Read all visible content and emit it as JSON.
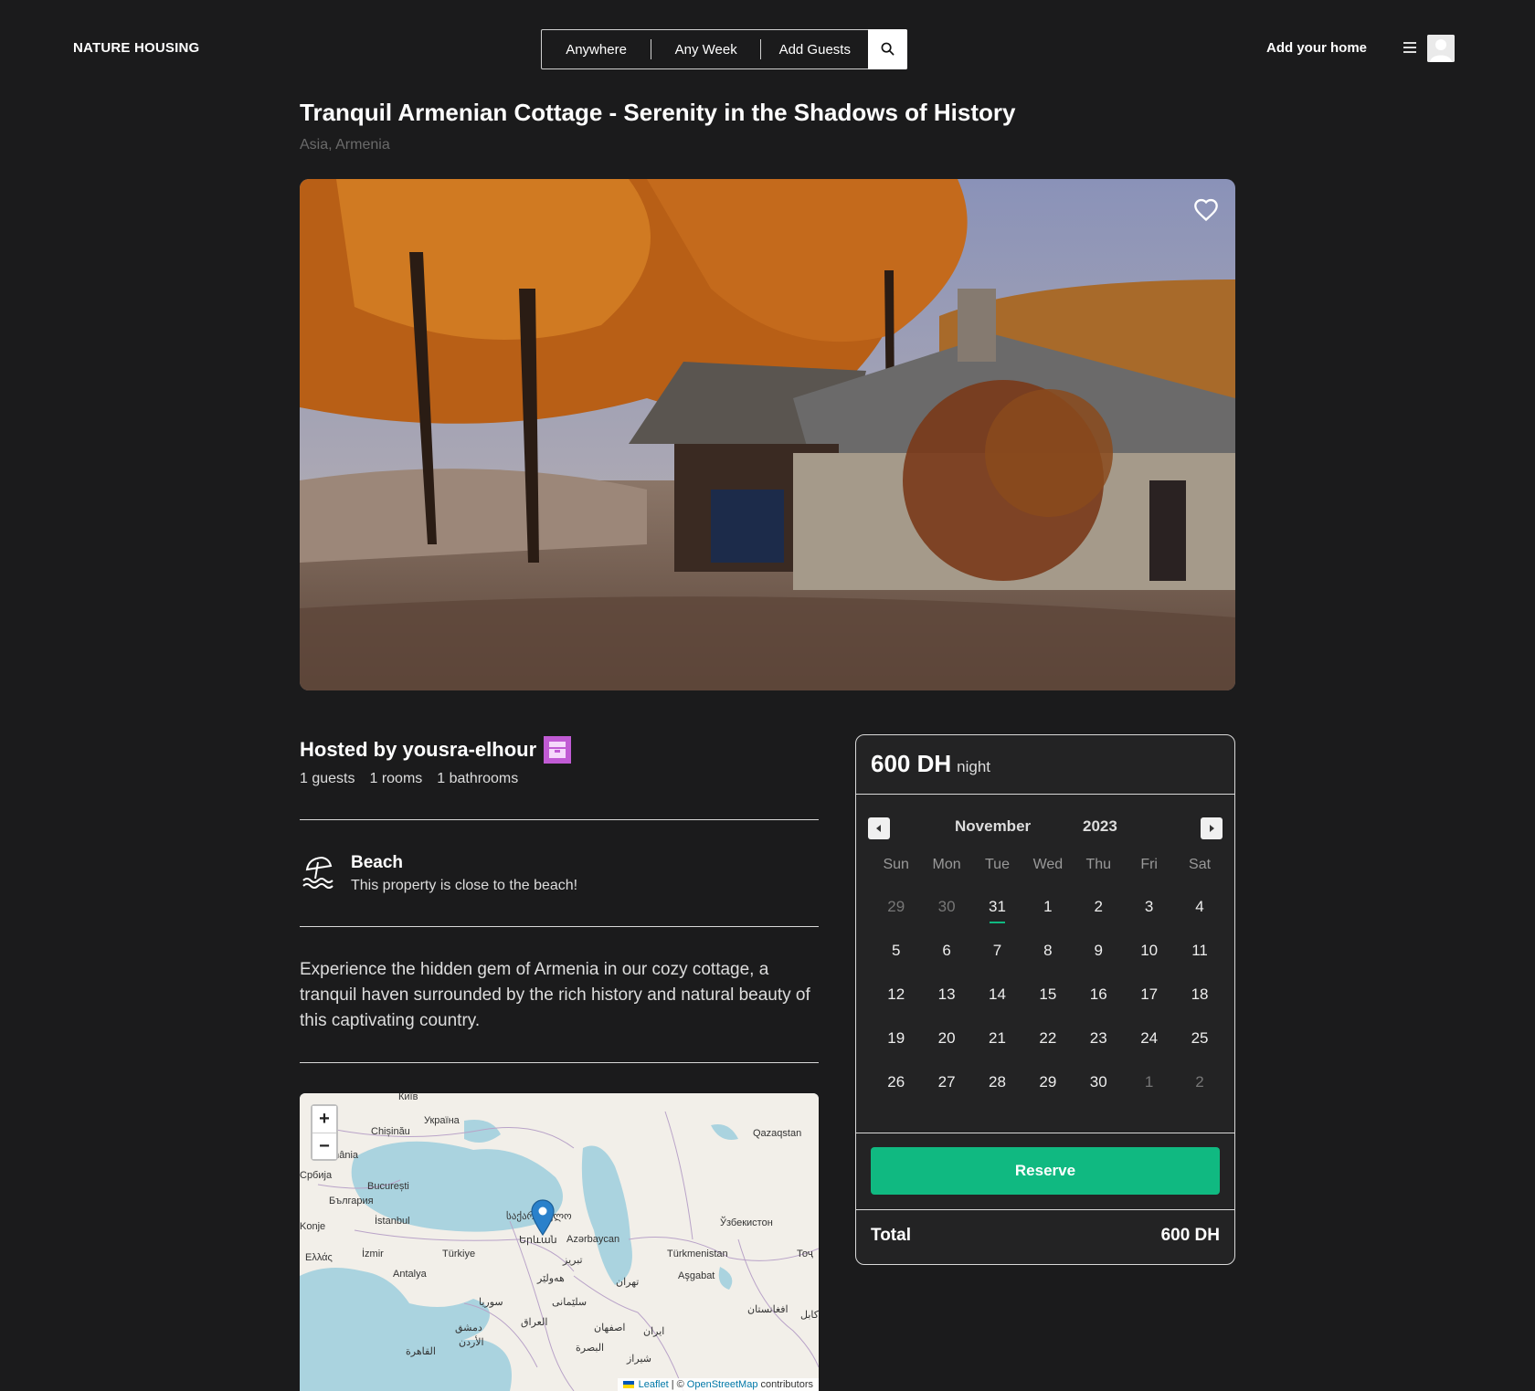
{
  "header": {
    "logo": "NATURE HOUSING",
    "search": {
      "anywhere": "Anywhere",
      "any_week": "Any Week",
      "add_guests": "Add Guests"
    },
    "add_home": "Add your home"
  },
  "listing": {
    "title": "Tranquil Armenian Cottage - Serenity in the Shadows of History",
    "location": "Asia, Armenia",
    "host": "Hosted by yousra-elhour",
    "stats": [
      "1 guests",
      "1 rooms",
      "1 bathrooms"
    ],
    "feature": {
      "icon": "beach-umbrella-icon",
      "title": "Beach",
      "description": "This property is close to the beach!"
    },
    "description": "Experience the hidden gem of Armenia in our cozy cottage, a tranquil haven surrounded by the rich history and natural beauty of this captivating country."
  },
  "map": {
    "zoom_in": "+",
    "zoom_out": "−",
    "attribution_leaflet": "Leaflet",
    "attribution_sep": " | © ",
    "attribution_osm": "OpenStreetMap",
    "attribution_rest": " contributors",
    "labels": [
      "Київ",
      "Україна",
      "Chișinău",
      "România",
      "București",
      "България",
      "İstanbul",
      "Türkiye",
      "İzmir",
      "Ελλάς",
      "Antalya",
      "Konje",
      "Qazaqstan",
      "Ўзбекистон",
      "Türkmenistan",
      "Aşgabat",
      "Azərbaycan",
      "საქართველო",
      "Երևան",
      "تبریز",
      "هەولێر",
      "سلێمانی",
      "تهران",
      "سوريا",
      "العراق",
      "دمشق",
      "الأردن",
      "القاهرة",
      "اصفهان",
      "ایران",
      "البصرة",
      "شیراز",
      "افغانستان",
      "کابل",
      "Тоҷ",
      "Србија"
    ]
  },
  "booking": {
    "price": "600 DH",
    "per": "night",
    "month": "November",
    "year": "2023",
    "weekdays": [
      "Sun",
      "Mon",
      "Tue",
      "Wed",
      "Thu",
      "Fri",
      "Sat"
    ],
    "days": [
      {
        "d": "29",
        "other": true
      },
      {
        "d": "30",
        "other": true
      },
      {
        "d": "31",
        "other": false,
        "today": true
      },
      {
        "d": "1"
      },
      {
        "d": "2"
      },
      {
        "d": "3"
      },
      {
        "d": "4"
      },
      {
        "d": "5"
      },
      {
        "d": "6"
      },
      {
        "d": "7"
      },
      {
        "d": "8"
      },
      {
        "d": "9"
      },
      {
        "d": "10"
      },
      {
        "d": "11"
      },
      {
        "d": "12"
      },
      {
        "d": "13"
      },
      {
        "d": "14"
      },
      {
        "d": "15"
      },
      {
        "d": "16"
      },
      {
        "d": "17"
      },
      {
        "d": "18"
      },
      {
        "d": "19"
      },
      {
        "d": "20"
      },
      {
        "d": "21"
      },
      {
        "d": "22"
      },
      {
        "d": "23"
      },
      {
        "d": "24"
      },
      {
        "d": "25"
      },
      {
        "d": "26"
      },
      {
        "d": "27"
      },
      {
        "d": "28"
      },
      {
        "d": "29"
      },
      {
        "d": "30"
      },
      {
        "d": "1",
        "other": true
      },
      {
        "d": "2",
        "other": true
      }
    ],
    "reserve_label": "Reserve",
    "total_label": "Total",
    "total_value": "600 DH"
  },
  "colors": {
    "background": "#1b1b1c",
    "accent": "#10b981",
    "host_badge": "#c15bd4"
  }
}
